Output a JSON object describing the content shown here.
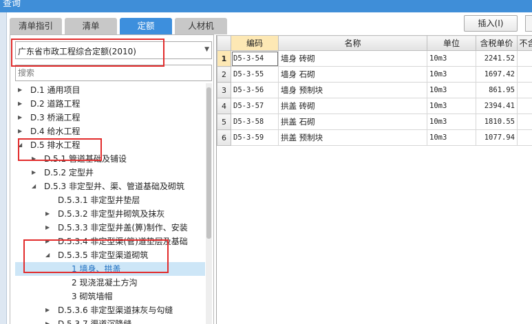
{
  "window": {
    "title": "查询"
  },
  "tabs": [
    {
      "label": "清单指引",
      "active": false
    },
    {
      "label": "清单",
      "active": false
    },
    {
      "label": "定额",
      "active": true
    },
    {
      "label": "人材机",
      "active": false
    }
  ],
  "toolbar": {
    "insert_label": "插入(I)"
  },
  "left": {
    "quota_select": "广东省市政工程综合定额(2010)",
    "search_placeholder": "搜索",
    "tree": [
      {
        "label": "D.1 通用项目",
        "arrow": "▶"
      },
      {
        "label": "D.2 道路工程",
        "arrow": "▶"
      },
      {
        "label": "D.3 桥涵工程",
        "arrow": "▶"
      },
      {
        "label": "D.4 给水工程",
        "arrow": "▶"
      },
      {
        "label": "D.5 排水工程",
        "arrow": "◢"
      },
      {
        "label": "D.5.1 管道基础及铺设",
        "arrow": "▶"
      },
      {
        "label": "D.5.2 定型井",
        "arrow": "▶"
      },
      {
        "label": "D.5.3 非定型井、渠、管道基础及砌筑",
        "arrow": "◢"
      },
      {
        "label": "D.5.3.1 非定型井垫层",
        "arrow": ""
      },
      {
        "label": "D.5.3.2 非定型井砌筑及抹灰",
        "arrow": "▶"
      },
      {
        "label": "D.5.3.3 非定型井盖(箅)制作、安装",
        "arrow": "▶"
      },
      {
        "label": "D.5.3.4 非定型渠(管)道垫层及基础",
        "arrow": "▶"
      },
      {
        "label": "D.5.3.5 非定型渠道砌筑",
        "arrow": "◢"
      },
      {
        "label": "1 墙身、拱盖",
        "arrow": ""
      },
      {
        "label": "2 现浇混凝土方沟",
        "arrow": ""
      },
      {
        "label": "3 砌筑墙帽",
        "arrow": ""
      },
      {
        "label": "D.5.3.6 非定型渠道抹灰与勾缝",
        "arrow": "▶"
      },
      {
        "label": "D.5.3.7 渠道沉降缝",
        "arrow": "▶"
      }
    ]
  },
  "grid": {
    "headers": [
      "编码",
      "名称",
      "单位",
      "含税单价",
      "不含"
    ],
    "rows": [
      {
        "n": "1",
        "code": "D5-3-54",
        "name": "墙身 砖砌",
        "unit": "10m3",
        "price": "2241.52"
      },
      {
        "n": "2",
        "code": "D5-3-55",
        "name": "墙身 石砌",
        "unit": "10m3",
        "price": "1697.42"
      },
      {
        "n": "3",
        "code": "D5-3-56",
        "name": "墙身 预制块",
        "unit": "10m3",
        "price": "861.95"
      },
      {
        "n": "4",
        "code": "D5-3-57",
        "name": "拱盖 砖砌",
        "unit": "10m3",
        "price": "2394.41"
      },
      {
        "n": "5",
        "code": "D5-3-58",
        "name": "拱盖 石砌",
        "unit": "10m3",
        "price": "1810.55"
      },
      {
        "n": "6",
        "code": "D5-3-59",
        "name": "拱盖 预制块",
        "unit": "10m3",
        "price": "1077.94"
      }
    ]
  },
  "colors": {
    "titlebar": "#3f8ed8",
    "tab_active": "#3d8fdd",
    "tab_inactive": "#c8c8c8",
    "selected_row": "#cde6f7",
    "highlight": "#fde8b4",
    "annotation": "#e22b2b"
  }
}
